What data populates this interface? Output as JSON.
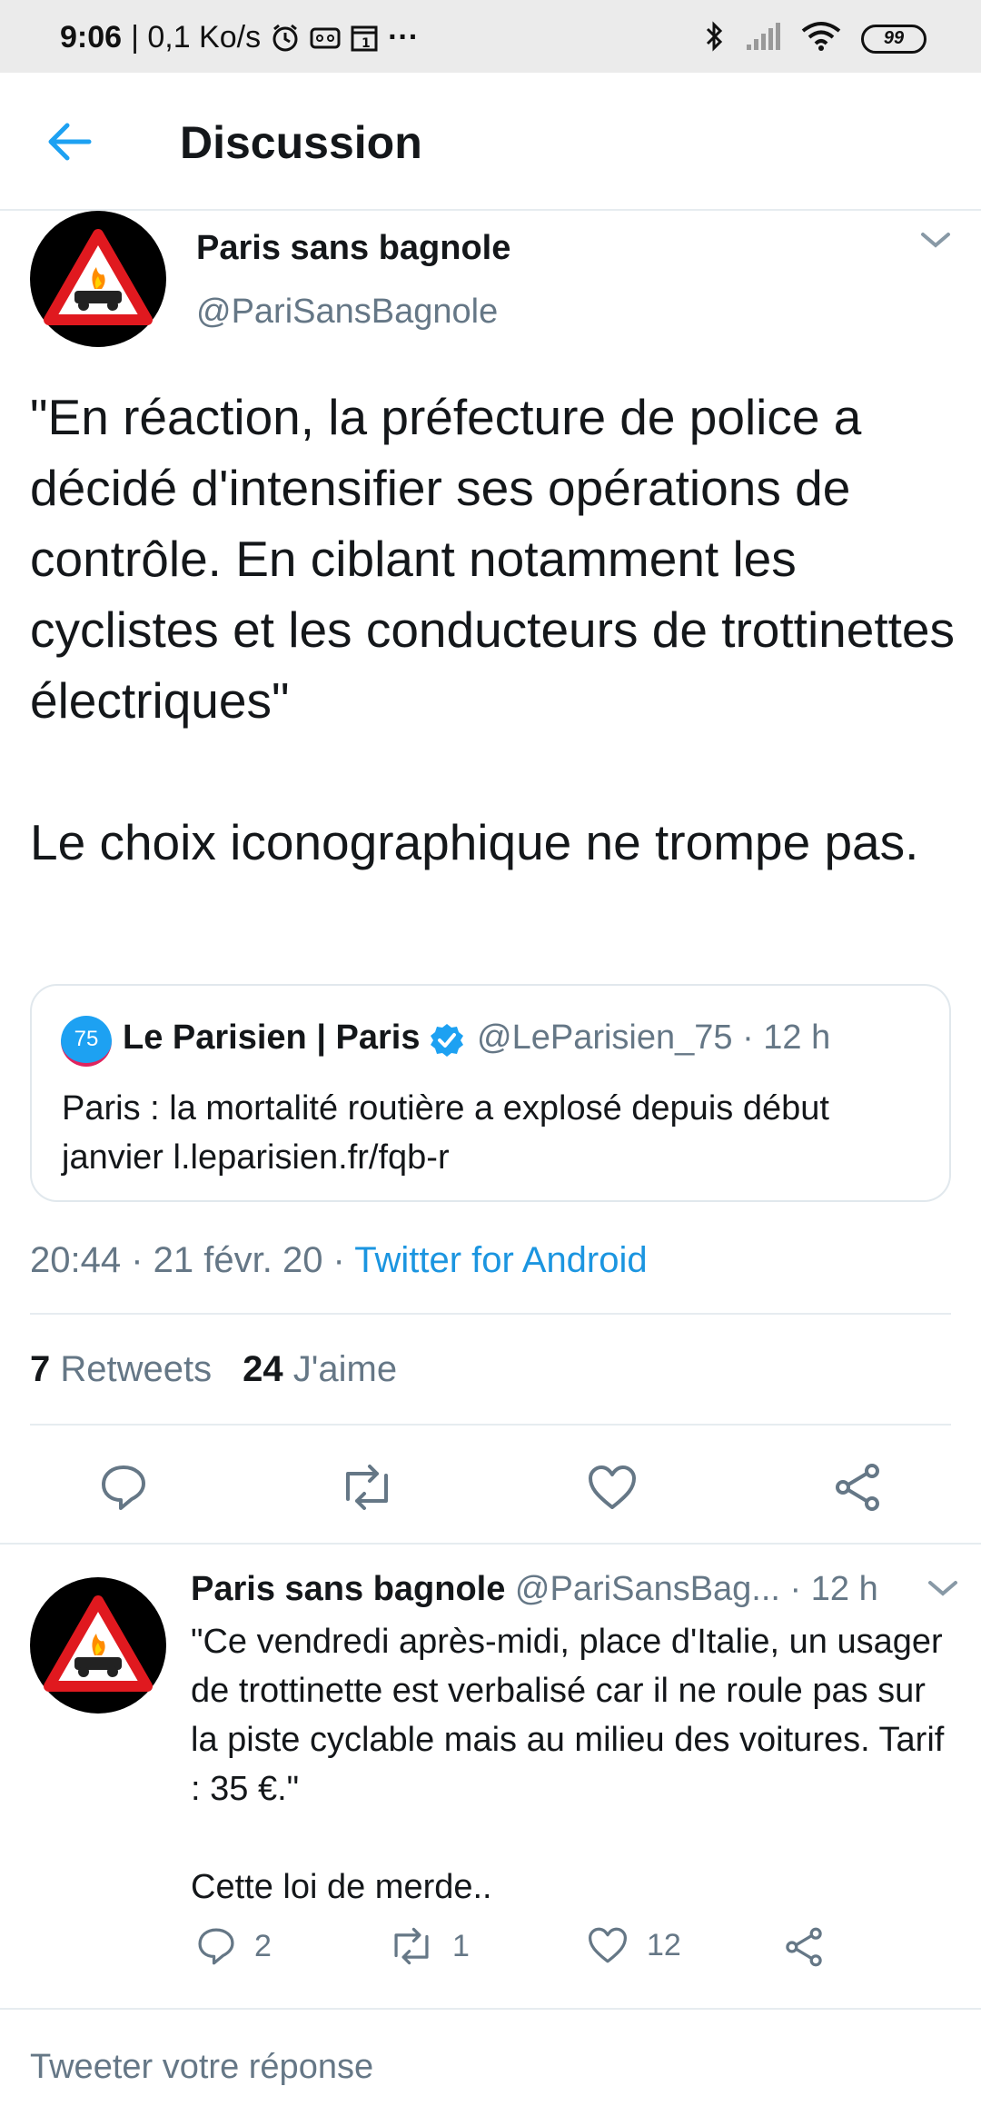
{
  "status_bar": {
    "time": "9:06",
    "speed": "| 0,1 Ko/s",
    "more": "···",
    "battery": "99"
  },
  "header": {
    "title": "Discussion"
  },
  "main_tweet": {
    "author_name": "Paris sans bagnole",
    "author_handle": "@PariSansBagnole",
    "text": "\"En réaction, la préfecture de police a décidé d'intensifier ses opérations de contrôle. En ciblant notamment les cyclistes et les conducteurs de trottinettes électriques\"\n\nLe choix iconographique ne trompe pas.",
    "quote": {
      "badge": "75",
      "name": "Le Parisien | Paris",
      "handle_time": "@LeParisien_75 · 12 h",
      "text": "Paris : la mortalité routière a explosé depuis début janvier l.leparisien.fr/fqb-r"
    },
    "timestamp": "20:44 · 21 févr. 20 · ",
    "client": "Twitter for Android",
    "retweets_count": "7",
    "retweets_label": "Retweets",
    "likes_count": "24",
    "likes_label": "J'aime"
  },
  "reply": {
    "author_name": "Paris sans bagnole",
    "handle_time": " @PariSansBag... · 12 h",
    "text": "\"Ce vendredi après-midi, place d'Italie, un usager de trottinette est verbalisé car il ne roule pas sur la piste cyclable mais au milieu des voitures. Tarif : 35 €.\"\n\nCette loi de merde..",
    "replies": "2",
    "retweets": "1",
    "likes": "12"
  },
  "compose": {
    "placeholder": "Tweeter votre réponse"
  },
  "colors": {
    "accent": "#1da1f2",
    "link": "#1b95e0",
    "secondary_text": "#657786",
    "primary_text": "#14171a",
    "avatar_warning_red": "#e0191f"
  }
}
